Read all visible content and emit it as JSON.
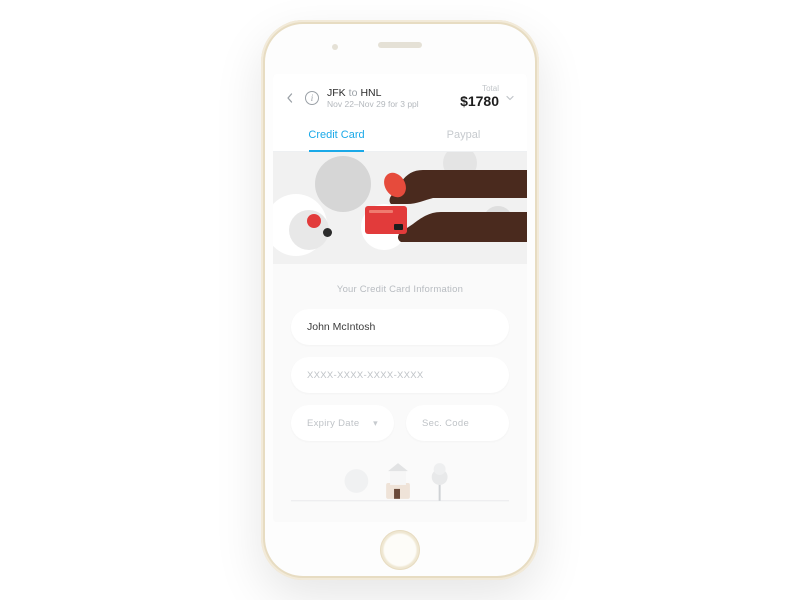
{
  "header": {
    "from": "JFK",
    "to_word": "to",
    "to": "HNL",
    "subtitle": "Nov 22–Nov 29 for 3 ppl",
    "total_label": "Total",
    "total_amount": "$1780"
  },
  "tabs": {
    "credit_card": "Credit Card",
    "paypal": "Paypal"
  },
  "form": {
    "section_title": "Your Credit Card  Information",
    "name_value": "John McIntosh",
    "card_placeholder": "XXXX-XXXX-XXXX-XXXX",
    "expiry_label": "Expiry Date",
    "sec_label": "Sec. Code"
  }
}
